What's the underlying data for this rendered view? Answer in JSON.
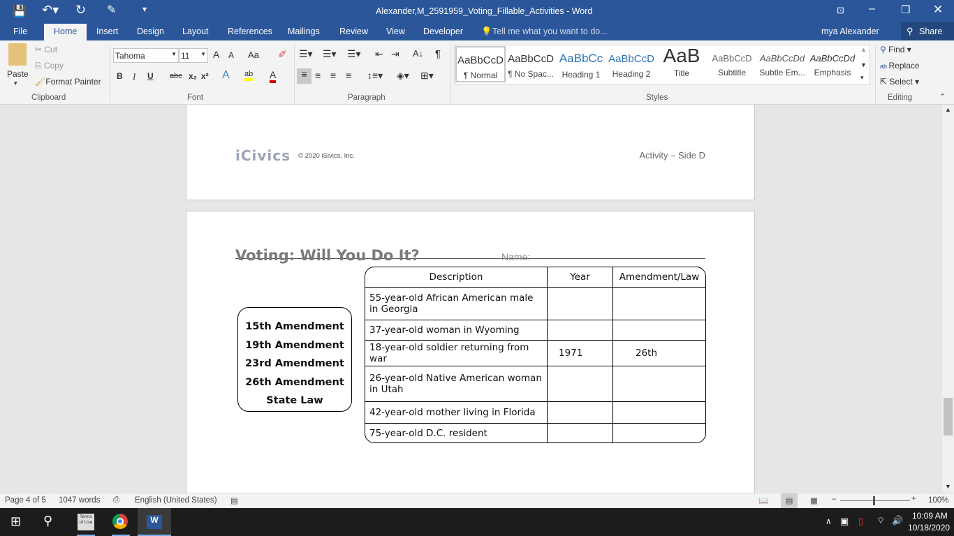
{
  "window": {
    "title": "Alexander,M_2591959_Voting_Fillable_Activities - Word"
  },
  "tabs": [
    "File",
    "Home",
    "Insert",
    "Design",
    "Layout",
    "References",
    "Mailings",
    "Review",
    "View",
    "Developer"
  ],
  "tell_me": "Tell me what you want to do...",
  "user": "mya Alexander",
  "share": "Share",
  "clipboard": {
    "paste": "Paste",
    "cut": "Cut",
    "copy": "Copy",
    "format_painter": "Format Painter",
    "label": "Clipboard"
  },
  "font": {
    "name": "Tahoma",
    "size": "11",
    "label": "Font",
    "bold": "B",
    "italic": "I",
    "underline": "U",
    "strike": "abc",
    "sub": "x₂",
    "sup": "x²",
    "case": "Aa"
  },
  "paragraph": {
    "label": "Paragraph"
  },
  "styles": {
    "label": "Styles",
    "items": [
      {
        "preview": "AaBbCcD",
        "name": "¶ Normal"
      },
      {
        "preview": "AaBbCcD",
        "name": "¶ No Spac..."
      },
      {
        "preview": "AaBbCc",
        "name": "Heading 1"
      },
      {
        "preview": "AaBbCcD",
        "name": "Heading 2"
      },
      {
        "preview": "AaB",
        "name": "Title"
      },
      {
        "preview": "AaBbCcD",
        "name": "Subtitle"
      },
      {
        "preview": "AaBbCcDd",
        "name": "Subtle Em..."
      },
      {
        "preview": "AaBbCcDd",
        "name": "Emphasis"
      }
    ]
  },
  "editing": {
    "find": "Find",
    "replace": "Replace",
    "select": "Select",
    "label": "Editing"
  },
  "page3": {
    "logo": "iCivics",
    "copyright": "© 2020 iSivics, Inc.",
    "footer_right": "Activity – Side D"
  },
  "page4": {
    "title": "Voting: Will You Do It?",
    "name_label": "Name:",
    "options": [
      "15th Amendment",
      "19th Amendment",
      "23rd Amendment",
      "26th Amendment",
      "State Law"
    ],
    "table": {
      "headers": [
        "Description",
        "Year",
        "Amendment/Law"
      ],
      "rows": [
        [
          "55-year-old African American male in Georgia",
          "",
          ""
        ],
        [
          "37-year-old woman in Wyoming",
          "",
          ""
        ],
        [
          "18-year-old soldier returning from war",
          "1971",
          "26th"
        ],
        [
          "26-year-old Native American woman in Utah",
          "",
          ""
        ],
        [
          "42-year-old mother living in Florida",
          "",
          ""
        ],
        [
          "75-year-old D.C. resident",
          "",
          ""
        ]
      ]
    }
  },
  "status": {
    "page": "Page 4 of 5",
    "words": "1047 words",
    "language": "English (United States)",
    "zoom": "100%"
  },
  "taskbar": {
    "time": "10:09 AM",
    "date": "10/18/2020",
    "terms": "Terms of Use"
  }
}
